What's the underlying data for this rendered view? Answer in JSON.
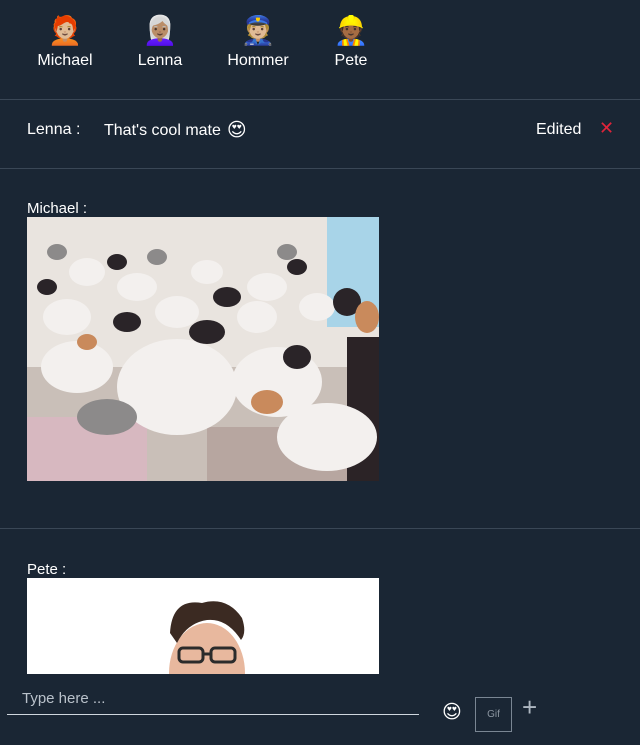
{
  "users": [
    {
      "name": "Michael",
      "avatar": "🧑🏼‍🦰",
      "avatar_icon": "red-haired-person-icon"
    },
    {
      "name": "Lenna",
      "avatar": "👩🏽‍🦳",
      "avatar_icon": "white-haired-woman-icon"
    },
    {
      "name": "Hommer",
      "avatar": "👮🏼",
      "avatar_icon": "police-officer-icon"
    },
    {
      "name": "Pete",
      "avatar": "👷🏾",
      "avatar_icon": "construction-worker-icon"
    }
  ],
  "edited_message": {
    "sender": "Lenna :",
    "text": "That's cool mate",
    "emoji": "😍",
    "status": "Edited",
    "close_symbol": "✕"
  },
  "posts": [
    {
      "sender": "Michael :",
      "image": "photo of many cats on a bed"
    },
    {
      "sender": "Pete :",
      "image": "photo of a smiling man with glasses"
    }
  ],
  "composer": {
    "placeholder": "Type here ...",
    "emoji": "😍",
    "gif_label": "Gif",
    "plus_label": "+"
  },
  "colors": {
    "background": "#1a2634",
    "divider": "#3a4756",
    "close": "#e0243a"
  }
}
